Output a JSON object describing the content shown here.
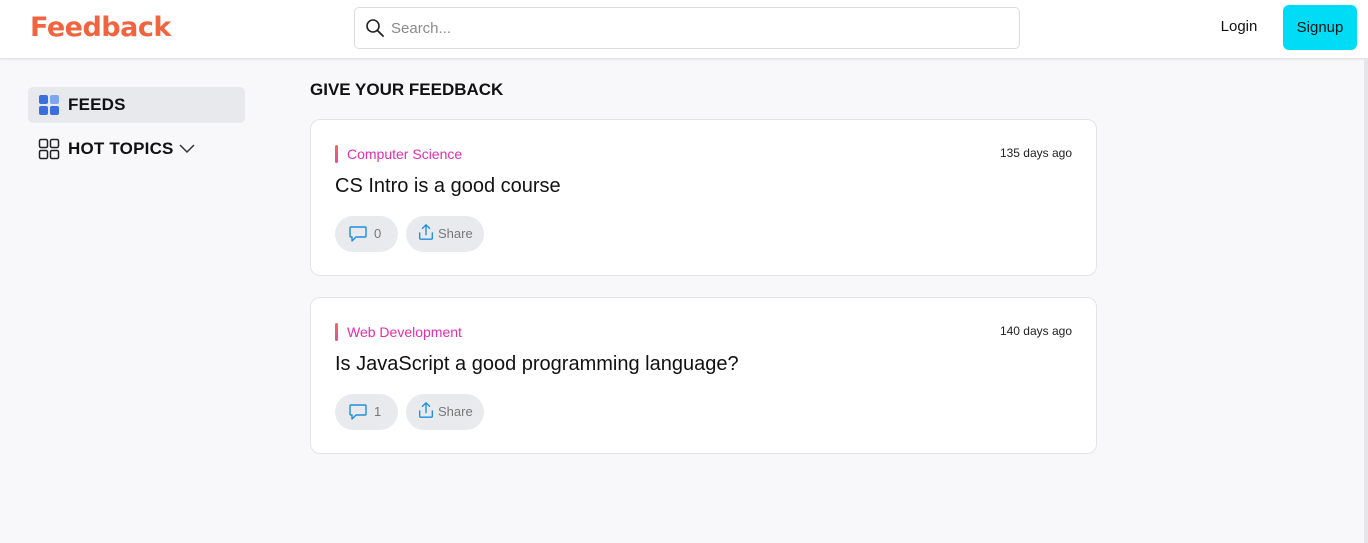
{
  "header": {
    "logo": "Feedback",
    "search_placeholder": "Search...",
    "login_label": "Login",
    "signup_label": "Signup"
  },
  "colors": {
    "logo": "#f0643f",
    "signup_bg": "#00dcf5",
    "category": "#e02fae",
    "icon_accent": "#1a8fe0"
  },
  "sidebar": {
    "items": [
      {
        "label": "FEEDS",
        "icon": "grid-icon",
        "active": true
      },
      {
        "label": "HOT TOPICS",
        "icon": "grid-outline-icon",
        "active": false,
        "expandable": true
      }
    ]
  },
  "main": {
    "section_title": "GIVE YOUR FEEDBACK",
    "posts": [
      {
        "category": "Computer Science",
        "time": "135 days ago",
        "title": "CS Intro is a good course",
        "comments": "0",
        "share_label": "Share"
      },
      {
        "category": "Web Development",
        "time": "140 days ago",
        "title": "Is JavaScript a good programming language?",
        "comments": "1",
        "share_label": "Share"
      }
    ]
  }
}
